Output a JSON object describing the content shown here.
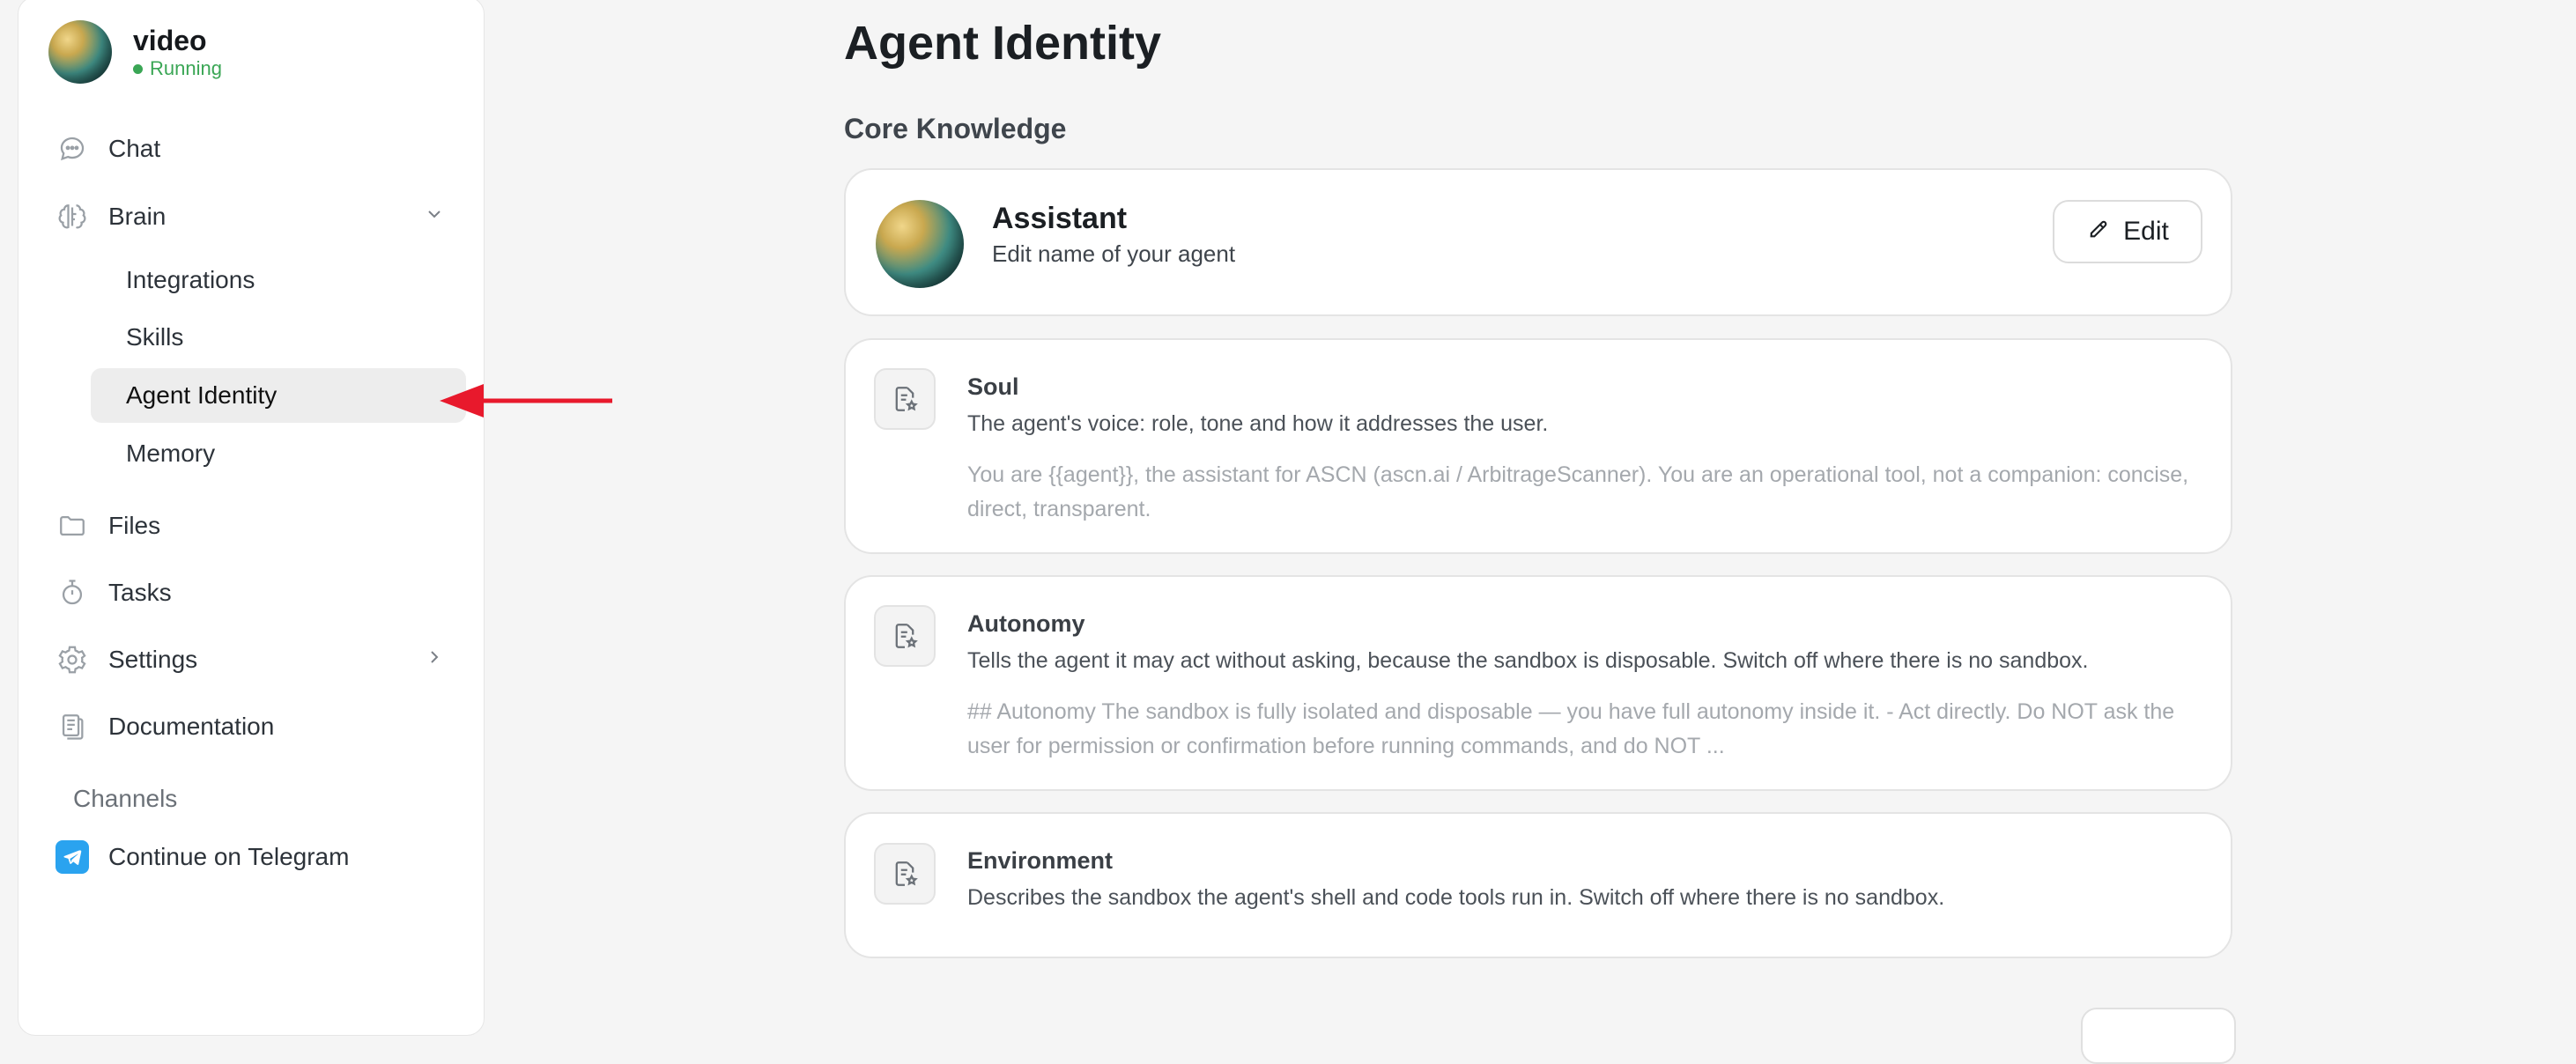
{
  "agent": {
    "name": "video",
    "status": "Running"
  },
  "sidebar": {
    "items": [
      {
        "label": "Chat"
      },
      {
        "label": "Brain"
      },
      {
        "label": "Files"
      },
      {
        "label": "Tasks"
      },
      {
        "label": "Settings"
      },
      {
        "label": "Documentation"
      }
    ],
    "brain_sub": [
      {
        "label": "Integrations"
      },
      {
        "label": "Skills"
      },
      {
        "label": "Agent Identity"
      },
      {
        "label": "Memory"
      }
    ],
    "channels_title": "Channels",
    "telegram_label": "Continue on Telegram"
  },
  "main": {
    "title": "Agent Identity",
    "section": "Core Knowledge",
    "assistant": {
      "name": "Assistant",
      "subtitle": "Edit name of your agent",
      "edit_label": "Edit"
    },
    "cards": [
      {
        "title": "Soul",
        "desc": "The agent's voice: role, tone and how it addresses the user.",
        "prompt": "You are {{agent}}, the assistant for ASCN (ascn.ai / ArbitrageScanner). You are an operational tool, not a companion: concise, direct, transparent."
      },
      {
        "title": "Autonomy",
        "desc": "Tells the agent it may act without asking, because the sandbox is disposable. Switch off where there is no sandbox.",
        "prompt": "## Autonomy The sandbox is fully isolated and disposable — you have full autonomy inside it. - Act directly. Do NOT ask the user for permission or confirmation before running commands, and do NOT ..."
      },
      {
        "title": "Environment",
        "desc": "Describes the sandbox the agent's shell and code tools run in. Switch off where there is no sandbox."
      }
    ]
  },
  "colors": {
    "accent_running": "#3aa655",
    "arrow": "#e8192c",
    "telegram": "#2aa3ef",
    "active_bg": "#ededed"
  }
}
